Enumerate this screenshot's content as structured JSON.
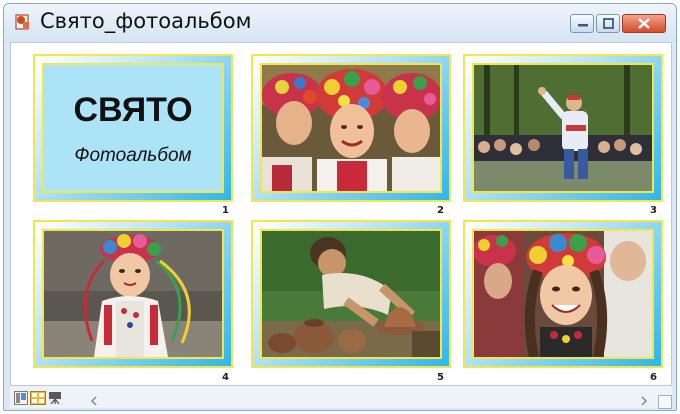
{
  "window": {
    "title": "Свято_фотоальбом",
    "controls": [
      "minimize-icon",
      "maximize-icon",
      "close-icon"
    ]
  },
  "colors": {
    "frame_outer": "#f2e64a",
    "frame_gradient_end": "#2fb6e8",
    "cover_bg": "#ade3f7",
    "close_button": "#d24b2a"
  },
  "slides": [
    {
      "number": "1",
      "type": "cover",
      "title": "СВЯТО",
      "subtitle": "Фотоальбом"
    },
    {
      "number": "2",
      "type": "photo",
      "icon": "girls-in-wreaths-photo"
    },
    {
      "number": "3",
      "type": "photo",
      "icon": "dancer-crowd-photo"
    },
    {
      "number": "4",
      "type": "photo",
      "icon": "little-girl-wreath-photo"
    },
    {
      "number": "5",
      "type": "photo",
      "icon": "potter-wheel-photo"
    },
    {
      "number": "6",
      "type": "photo",
      "icon": "smiling-girl-wreath-photo"
    }
  ],
  "statusbar": {
    "view_buttons": [
      "normal-view-icon",
      "slide-sorter-view-icon",
      "slideshow-icon"
    ]
  }
}
